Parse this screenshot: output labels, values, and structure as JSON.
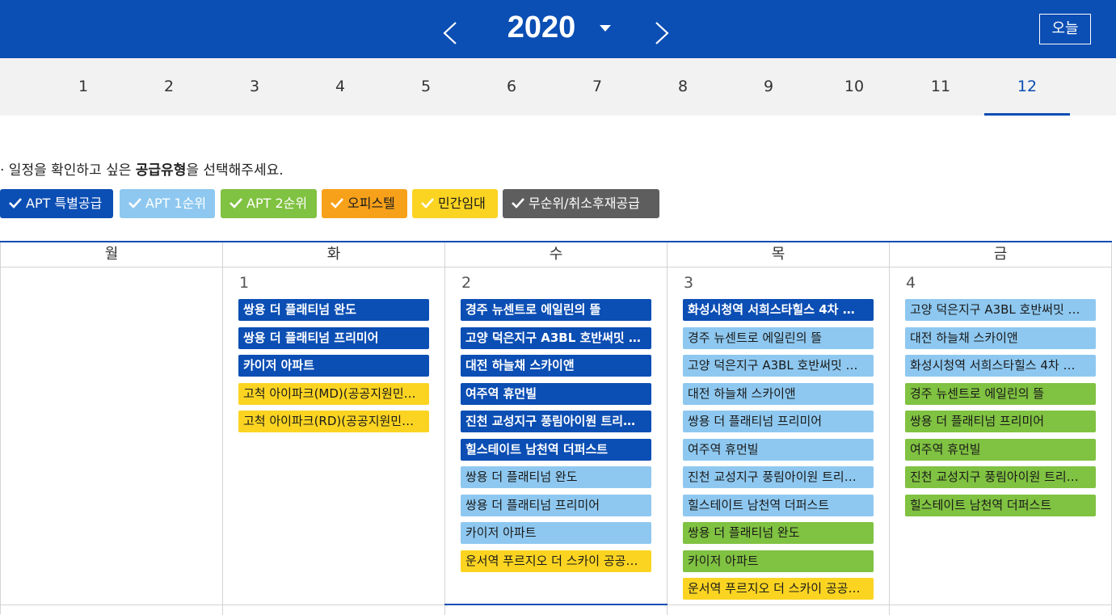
{
  "header": {
    "year": "2020",
    "today_label": "오늘",
    "colors": {
      "bar": "#0b4eb4"
    }
  },
  "months": [
    "1",
    "2",
    "3",
    "4",
    "5",
    "6",
    "7",
    "8",
    "9",
    "10",
    "11",
    "12"
  ],
  "active_month": "12",
  "hint": {
    "prefix": "· 일정을 확인하고 싶은 ",
    "bold": "공급유형",
    "suffix": "을 선택해주세요."
  },
  "filters": [
    {
      "label": "APT 특별공급",
      "color": "#0b4eb4",
      "text_color": "#ffffff"
    },
    {
      "label": "APT 1순위",
      "color": "#8ec8f0",
      "text_color": "#ffffff"
    },
    {
      "label": "APT 2순위",
      "color": "#80c241",
      "text_color": "#ffffff"
    },
    {
      "label": "오피스텔",
      "color": "#f7a11a",
      "text_color": "#1a1a1a"
    },
    {
      "label": "민간임대",
      "color": "#fbd422",
      "text_color": "#1a1a1a"
    },
    {
      "label": "무순위/취소후재공급",
      "color": "#5e5e5e",
      "text_color": "#ffffff"
    }
  ],
  "weekdays": [
    "월",
    "화",
    "수",
    "목",
    "금"
  ],
  "days": [
    {
      "num": "",
      "events": []
    },
    {
      "num": "1",
      "events": [
        {
          "title": "쌍용 더 플래티넘 완도",
          "type": "special"
        },
        {
          "title": "쌍용 더 플래티넘 프리미어",
          "type": "special"
        },
        {
          "title": "카이저 아파트",
          "type": "special"
        },
        {
          "title": "고척 아이파크(MD)(공공지원민…",
          "type": "rental"
        },
        {
          "title": "고척 아이파크(RD)(공공지원민…",
          "type": "rental"
        }
      ]
    },
    {
      "num": "2",
      "events": [
        {
          "title": "경주 뉴센트로 에일린의 뜰",
          "type": "special"
        },
        {
          "title": "고양 덕은지구 A3BL 호반써밋 …",
          "type": "special"
        },
        {
          "title": "대전 하늘채 스카이앤",
          "type": "special"
        },
        {
          "title": "여주역 휴먼빌",
          "type": "special"
        },
        {
          "title": "진천 교성지구 풍림아이원 트리…",
          "type": "special"
        },
        {
          "title": "힐스테이트 남천역 더퍼스트",
          "type": "special"
        },
        {
          "title": "쌍용 더 플래티넘 완도",
          "type": "first"
        },
        {
          "title": "쌍용 더 플래티넘 프리미어",
          "type": "first"
        },
        {
          "title": "카이저 아파트",
          "type": "first"
        },
        {
          "title": "운서역 푸르지오 더 스카이 공공…",
          "type": "rental"
        }
      ]
    },
    {
      "num": "3",
      "events": [
        {
          "title": "화성시청역 서희스타힐스 4차 …",
          "type": "special"
        },
        {
          "title": "경주 뉴센트로 에일린의 뜰",
          "type": "first"
        },
        {
          "title": "고양 덕은지구 A3BL 호반써밋 …",
          "type": "first"
        },
        {
          "title": "대전 하늘채 스카이앤",
          "type": "first"
        },
        {
          "title": "쌍용 더 플래티넘 프리미어",
          "type": "first"
        },
        {
          "title": "여주역 휴먼빌",
          "type": "first"
        },
        {
          "title": "진천 교성지구 풍림아이원 트리…",
          "type": "first"
        },
        {
          "title": "힐스테이트 남천역 더퍼스트",
          "type": "first"
        },
        {
          "title": "쌍용 더 플래티넘 완도",
          "type": "second"
        },
        {
          "title": "카이저 아파트",
          "type": "second"
        },
        {
          "title": "운서역 푸르지오 더 스카이 공공…",
          "type": "rental"
        }
      ]
    },
    {
      "num": "4",
      "events": [
        {
          "title": "고양 덕은지구 A3BL 호반써밋 …",
          "type": "first"
        },
        {
          "title": "대전 하늘채 스카이앤",
          "type": "first"
        },
        {
          "title": "화성시청역 서희스타힐스 4차 …",
          "type": "first"
        },
        {
          "title": "경주 뉴센트로 에일린의 뜰",
          "type": "second"
        },
        {
          "title": "쌍용 더 플래티넘 프리미어",
          "type": "second"
        },
        {
          "title": "여주역 휴먼빌",
          "type": "second"
        },
        {
          "title": "진천 교성지구 풍림아이원 트리…",
          "type": "second"
        },
        {
          "title": "힐스테이트 남천역 더퍼스트",
          "type": "second"
        }
      ]
    }
  ]
}
